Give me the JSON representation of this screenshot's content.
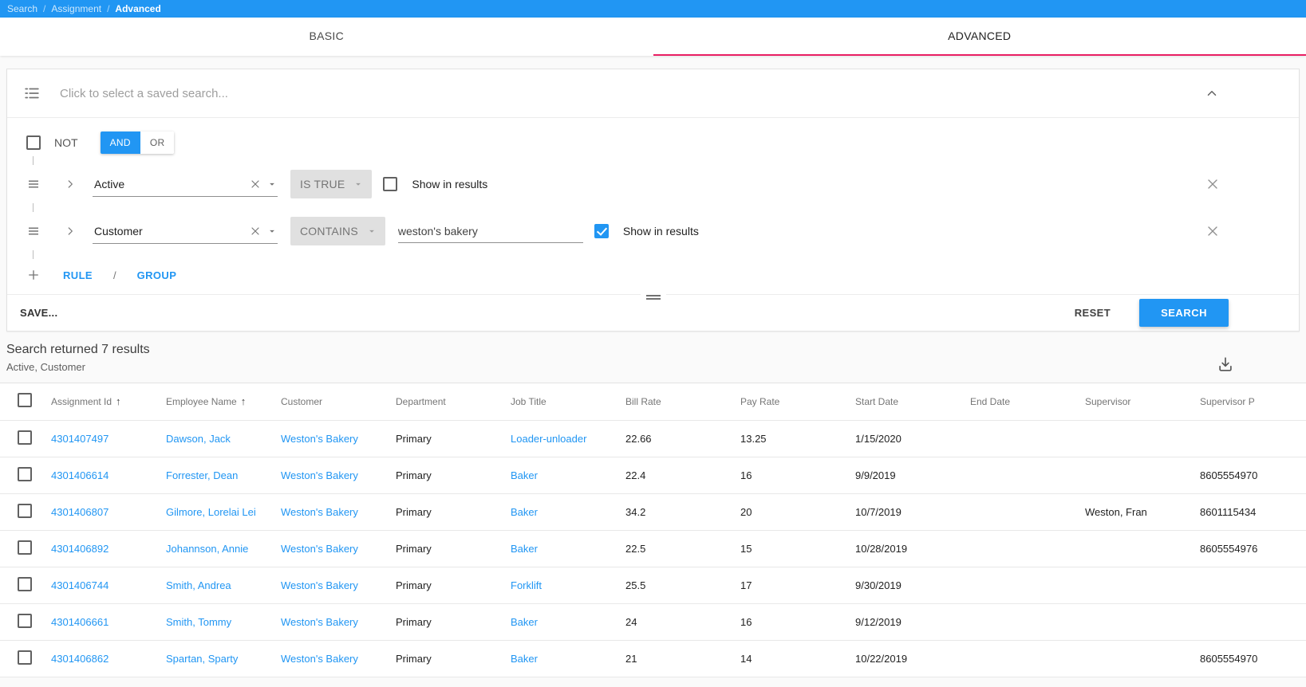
{
  "breadcrumb": {
    "separator": "/",
    "items": [
      {
        "label": "Search",
        "active": false
      },
      {
        "label": "Assignment",
        "active": false
      },
      {
        "label": "Advanced",
        "active": true
      }
    ]
  },
  "tabs": [
    {
      "label": "BASIC",
      "active": false
    },
    {
      "label": "ADVANCED",
      "active": true
    }
  ],
  "saved_search": {
    "placeholder": "Click to select a saved search..."
  },
  "builder": {
    "not_label": "NOT",
    "and_label": "AND",
    "or_label": "OR",
    "rules": [
      {
        "field": "Active",
        "operator": "IS TRUE",
        "value": "",
        "show_label": "Show in results",
        "show_checked": false
      },
      {
        "field": "Customer",
        "operator": "CONTAINS",
        "value": "weston's bakery",
        "show_label": "Show in results",
        "show_checked": true
      }
    ],
    "add_rule_label": "RULE",
    "add_separator": "/",
    "add_group_label": "GROUP",
    "save_label": "SAVE...",
    "reset_label": "RESET",
    "search_label": "SEARCH"
  },
  "results": {
    "summary": "Search returned 7 results",
    "filters": "Active, Customer"
  },
  "table": {
    "columns": [
      "Assignment Id",
      "Employee Name",
      "Customer",
      "Department",
      "Job Title",
      "Bill Rate",
      "Pay Rate",
      "Start Date",
      "End Date",
      "Supervisor",
      "Supervisor P"
    ],
    "sorted_columns": [
      0,
      1
    ],
    "link_columns": [
      0,
      1,
      2,
      4
    ],
    "rows": [
      [
        "4301407497",
        "Dawson, Jack",
        "Weston's Bakery",
        "Primary",
        "Loader-unloader",
        "22.66",
        "13.25",
        "1/15/2020",
        "",
        "",
        ""
      ],
      [
        "4301406614",
        "Forrester, Dean",
        "Weston's Bakery",
        "Primary",
        "Baker",
        "22.4",
        "16",
        "9/9/2019",
        "",
        "",
        "8605554970"
      ],
      [
        "4301406807",
        "Gilmore, Lorelai Lei",
        "Weston's Bakery",
        "Primary",
        "Baker",
        "34.2",
        "20",
        "10/7/2019",
        "",
        "Weston, Fran",
        "8601115434"
      ],
      [
        "4301406892",
        "Johannson, Annie",
        "Weston's Bakery",
        "Primary",
        "Baker",
        "22.5",
        "15",
        "10/28/2019",
        "",
        "",
        "8605554976"
      ],
      [
        "4301406744",
        "Smith, Andrea",
        "Weston's Bakery",
        "Primary",
        "Forklift",
        "25.5",
        "17",
        "9/30/2019",
        "",
        "",
        ""
      ],
      [
        "4301406661",
        "Smith, Tommy",
        "Weston's Bakery",
        "Primary",
        "Baker",
        "24",
        "16",
        "9/12/2019",
        "",
        "",
        ""
      ],
      [
        "4301406862",
        "Spartan, Sparty",
        "Weston's Bakery",
        "Primary",
        "Baker",
        "21",
        "14",
        "10/22/2019",
        "",
        "",
        "8605554970"
      ]
    ]
  },
  "colors": {
    "primary_blue": "#2196f3",
    "tab_accent_pink": "#e91e63",
    "link_blue": "#2196f3"
  }
}
